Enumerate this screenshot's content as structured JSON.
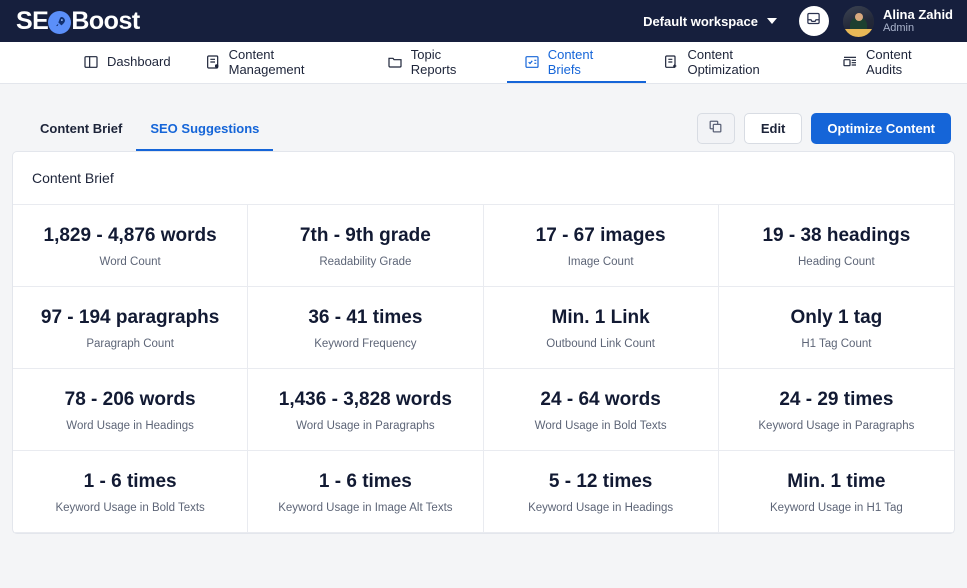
{
  "brand": {
    "name_part1": "SE",
    "name_part2": "Boost",
    "logo_icon": "rocket-icon"
  },
  "topbar": {
    "workspace_label": "Default workspace",
    "workspace_chevron_icon": "chevron-down-icon",
    "inbox_icon": "inbox-icon",
    "avatar_icon": "user-avatar",
    "user_name": "Alina Zahid",
    "user_role": "Admin",
    "bg_color": "#161f3d"
  },
  "nav": {
    "items": [
      {
        "label": "Dashboard",
        "icon": "dashboard-icon",
        "active": false
      },
      {
        "label": "Content Management",
        "icon": "content-management-icon",
        "active": false
      },
      {
        "label": "Topic Reports",
        "icon": "folder-icon",
        "active": false
      },
      {
        "label": "Content Briefs",
        "icon": "content-briefs-icon",
        "active": true
      },
      {
        "label": "Content Optimization",
        "icon": "content-optimization-icon",
        "active": false
      },
      {
        "label": "Content Audits",
        "icon": "content-audits-icon",
        "active": false
      }
    ],
    "accent_color": "#1565d8"
  },
  "subheader": {
    "tabs": [
      {
        "label": "Content Brief",
        "active": false
      },
      {
        "label": "SEO Suggestions",
        "active": true
      }
    ],
    "copy_button_icon": "copy-icon",
    "edit_label": "Edit",
    "optimize_label": "Optimize Content",
    "primary_color": "#1565d8"
  },
  "card": {
    "title": "Content Brief",
    "metrics": [
      {
        "value": "1,829 - 4,876 words",
        "label": "Word Count"
      },
      {
        "value": "7th - 9th grade",
        "label": "Readability Grade"
      },
      {
        "value": "17 - 67 images",
        "label": "Image Count"
      },
      {
        "value": "19 - 38 headings",
        "label": "Heading Count"
      },
      {
        "value": "97 - 194 paragraphs",
        "label": "Paragraph Count"
      },
      {
        "value": "36 - 41 times",
        "label": "Keyword Frequency"
      },
      {
        "value": "Min. 1 Link",
        "label": "Outbound Link Count"
      },
      {
        "value": "Only 1 tag",
        "label": "H1 Tag Count"
      },
      {
        "value": "78 - 206 words",
        "label": "Word Usage in Headings"
      },
      {
        "value": "1,436 - 3,828 words",
        "label": "Word Usage in Paragraphs"
      },
      {
        "value": "24 - 64 words",
        "label": "Word Usage in Bold Texts"
      },
      {
        "value": "24 - 29 times",
        "label": "Keyword Usage in Paragraphs"
      },
      {
        "value": "1 - 6 times",
        "label": "Keyword Usage in Bold Texts"
      },
      {
        "value": "1 - 6 times",
        "label": "Keyword Usage in Image Alt Texts"
      },
      {
        "value": "5 - 12 times",
        "label": "Keyword Usage in Headings"
      },
      {
        "value": "Min. 1 time",
        "label": "Keyword Usage in H1 Tag"
      }
    ]
  }
}
